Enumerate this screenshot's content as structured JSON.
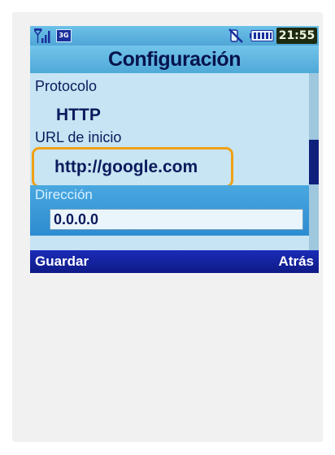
{
  "statusbar": {
    "network_badge": "3G",
    "time": "21:55",
    "icons": [
      "signal-icon",
      "mute-icon",
      "battery-icon"
    ],
    "battery_level": 1.0
  },
  "header": {
    "title": "Configuración"
  },
  "fields": {
    "protocol": {
      "label": "Protocolo",
      "value": "HTTP"
    },
    "home_url": {
      "label": "URL de inicio",
      "value": "http://google.com"
    },
    "address": {
      "label": "Dirección",
      "value": "0.0.0.0"
    }
  },
  "softkeys": {
    "left": "Guardar",
    "right": "Atrás"
  },
  "colors": {
    "highlight": "#efa015",
    "softbar": "#1b2cb8",
    "selected_row": "#2d8bd0",
    "title_text": "#07134d"
  }
}
